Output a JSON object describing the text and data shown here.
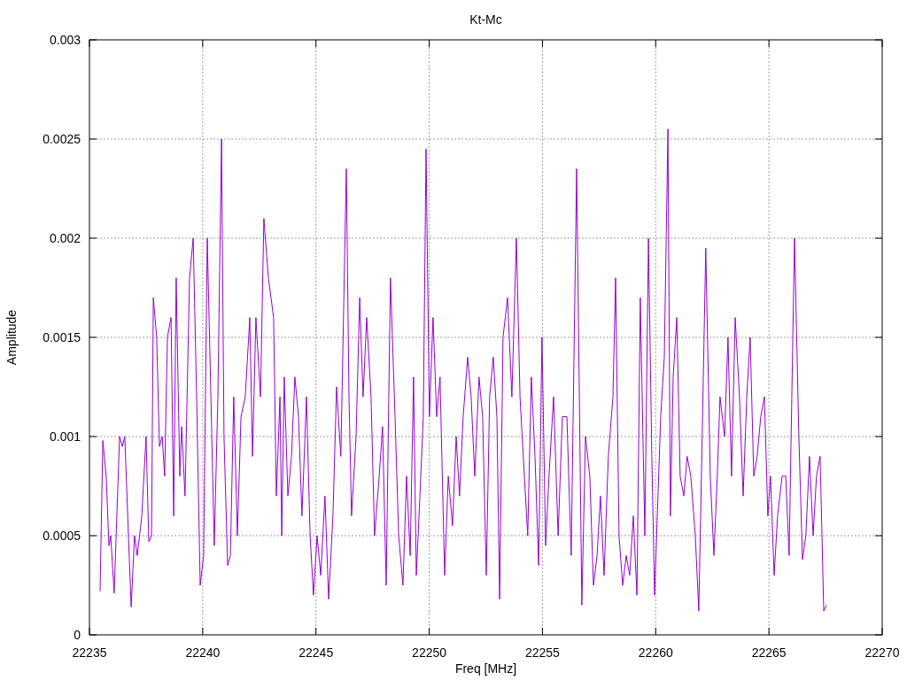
{
  "chart_data": {
    "type": "line",
    "title": "Kt-Mc",
    "xlabel": "Freq [MHz]",
    "ylabel": "Amplitude",
    "grid": true,
    "xlim": [
      22235,
      22270
    ],
    "ylim": [
      0,
      0.003
    ],
    "xticks": [
      {
        "value": 22235,
        "label": "22235"
      },
      {
        "value": 22240,
        "label": "22240"
      },
      {
        "value": 22245,
        "label": "22245"
      },
      {
        "value": 22250,
        "label": "22250"
      },
      {
        "value": 22255,
        "label": "22255"
      },
      {
        "value": 22260,
        "label": "22260"
      },
      {
        "value": 22265,
        "label": "22265"
      },
      {
        "value": 22270,
        "label": "22270"
      }
    ],
    "yticks": [
      {
        "value": 0,
        "label": "0"
      },
      {
        "value": 0.0005,
        "label": "0.0005"
      },
      {
        "value": 0.001,
        "label": "0.001"
      },
      {
        "value": 0.0015,
        "label": "0.0015"
      },
      {
        "value": 0.002,
        "label": "0.002"
      },
      {
        "value": 0.0025,
        "label": "0.0025"
      },
      {
        "value": 0.003,
        "label": "0.003"
      }
    ],
    "x": [
      22235.47,
      22235.59,
      22235.74,
      22235.86,
      22235.94,
      22236.09,
      22236.33,
      22236.45,
      22236.56,
      22236.72,
      22236.84,
      22236.99,
      22237.11,
      22237.31,
      22237.5,
      22237.62,
      22237.74,
      22237.82,
      22237.97,
      22238.09,
      22238.21,
      22238.32,
      22238.44,
      22238.6,
      22238.72,
      22238.83,
      22238.99,
      22239.07,
      22239.22,
      22239.42,
      22239.58,
      22239.73,
      22239.89,
      22240.04,
      22240.2,
      22240.36,
      22240.51,
      22240.67,
      22240.83,
      22240.94,
      22241.1,
      22241.22,
      22241.37,
      22241.53,
      22241.69,
      22241.88,
      22242.08,
      22242.2,
      22242.35,
      22242.55,
      22242.7,
      22242.9,
      22243.13,
      22243.25,
      22243.41,
      22243.49,
      22243.6,
      22243.76,
      22243.92,
      22244.07,
      22244.23,
      22244.38,
      22244.58,
      22244.74,
      22244.89,
      22245.05,
      22245.21,
      22245.4,
      22245.56,
      22245.75,
      22245.91,
      22246.1,
      22246.34,
      22246.46,
      22246.57,
      22246.77,
      22246.93,
      22247.08,
      22247.24,
      22247.43,
      22247.59,
      22247.79,
      22247.94,
      22248.1,
      22248.29,
      22248.49,
      22248.65,
      22248.84,
      22249.0,
      22249.16,
      22249.31,
      22249.43,
      22249.59,
      22249.74,
      22249.86,
      22250.01,
      22250.17,
      22250.33,
      22250.48,
      22250.68,
      22250.84,
      22251.03,
      22251.19,
      22251.34,
      22251.5,
      22251.7,
      22251.85,
      22252.01,
      22252.2,
      22252.36,
      22252.52,
      22252.67,
      22252.83,
      22252.99,
      22253.11,
      22253.26,
      22253.46,
      22253.65,
      22253.85,
      22254.01,
      22254.2,
      22254.35,
      22254.51,
      22254.67,
      22254.83,
      22254.98,
      22255.14,
      22255.29,
      22255.49,
      22255.69,
      22255.88,
      22256.08,
      22256.27,
      22256.51,
      22256.74,
      22256.9,
      22257.09,
      22257.25,
      22257.41,
      22257.56,
      22257.72,
      22257.91,
      22258.11,
      22258.23,
      22258.38,
      22258.54,
      22258.7,
      22258.85,
      22259.01,
      22259.17,
      22259.32,
      22259.52,
      22259.68,
      22259.83,
      22259.95,
      22260.07,
      22260.22,
      22260.38,
      22260.54,
      22260.65,
      22260.77,
      22260.93,
      22261.08,
      22261.24,
      22261.39,
      22261.55,
      22261.75,
      22261.9,
      22262.02,
      22262.21,
      22262.41,
      22262.57,
      22262.72,
      22262.84,
      22263.04,
      22263.19,
      22263.35,
      22263.51,
      22263.7,
      22263.86,
      22264.02,
      22264.17,
      22264.33,
      22264.48,
      22264.64,
      22264.8,
      22264.95,
      22265.07,
      22265.23,
      22265.38,
      22265.58,
      22265.74,
      22265.89,
      22266.13,
      22266.32,
      22266.48,
      22266.63,
      22266.79,
      22266.95,
      22267.1,
      22267.26,
      22267.42,
      22267.54
    ],
    "series": [
      {
        "color": "#9400d3",
        "values": [
          0.00022,
          0.00098,
          0.0008,
          0.00045,
          0.0005,
          0.00021,
          0.001,
          0.00095,
          0.001,
          0.0005,
          0.00014,
          0.0005,
          0.0004,
          0.0006,
          0.001,
          0.00047,
          0.0005,
          0.0017,
          0.0015,
          0.00095,
          0.001,
          0.0008,
          0.0015,
          0.0016,
          0.0006,
          0.0018,
          0.0008,
          0.00105,
          0.0007,
          0.0018,
          0.002,
          0.0012,
          0.00025,
          0.0004,
          0.002,
          0.0012,
          0.00045,
          0.0012,
          0.0025,
          0.001,
          0.00035,
          0.0004,
          0.0012,
          0.0005,
          0.0011,
          0.0012,
          0.0016,
          0.0009,
          0.0016,
          0.0012,
          0.0021,
          0.0018,
          0.0016,
          0.0007,
          0.0012,
          0.0005,
          0.0013,
          0.0007,
          0.0009,
          0.0013,
          0.0011,
          0.0006,
          0.0012,
          0.0005,
          0.0002,
          0.0005,
          0.0003,
          0.0007,
          0.00018,
          0.0006,
          0.00125,
          0.0009,
          0.00235,
          0.0012,
          0.0006,
          0.001,
          0.0017,
          0.0012,
          0.0016,
          0.0012,
          0.0005,
          0.0008,
          0.00105,
          0.00025,
          0.0018,
          0.0011,
          0.0005,
          0.00025,
          0.0008,
          0.0004,
          0.0013,
          0.0003,
          0.0007,
          0.0011,
          0.00245,
          0.0011,
          0.0016,
          0.0011,
          0.0013,
          0.0003,
          0.0008,
          0.00055,
          0.001,
          0.0007,
          0.0011,
          0.0014,
          0.0012,
          0.0008,
          0.0013,
          0.0011,
          0.0003,
          0.0012,
          0.0014,
          0.0011,
          0.00018,
          0.0015,
          0.0017,
          0.0012,
          0.002,
          0.0012,
          0.0008,
          0.0005,
          0.0013,
          0.0009,
          0.00035,
          0.0015,
          0.00045,
          0.0008,
          0.0012,
          0.0005,
          0.0011,
          0.0011,
          0.0004,
          0.00235,
          0.00015,
          0.001,
          0.0008,
          0.00025,
          0.0004,
          0.0007,
          0.0003,
          0.0009,
          0.0012,
          0.0018,
          0.0005,
          0.00025,
          0.0004,
          0.0003,
          0.0006,
          0.0002,
          0.0017,
          0.0005,
          0.002,
          0.0009,
          0.0002,
          0.0006,
          0.0011,
          0.0014,
          0.00255,
          0.0006,
          0.0013,
          0.0016,
          0.0008,
          0.0007,
          0.0009,
          0.0008,
          0.0005,
          0.00012,
          0.0008,
          0.00195,
          0.0008,
          0.0004,
          0.0008,
          0.0012,
          0.001,
          0.0015,
          0.0008,
          0.0016,
          0.0012,
          0.0007,
          0.0012,
          0.0015,
          0.0008,
          0.0009,
          0.0011,
          0.0012,
          0.0006,
          0.0008,
          0.0003,
          0.0006,
          0.0008,
          0.0008,
          0.0004,
          0.002,
          0.001,
          0.00038,
          0.0005,
          0.0009,
          0.0005,
          0.0008,
          0.0009,
          0.00012,
          0.00015
        ]
      }
    ]
  }
}
